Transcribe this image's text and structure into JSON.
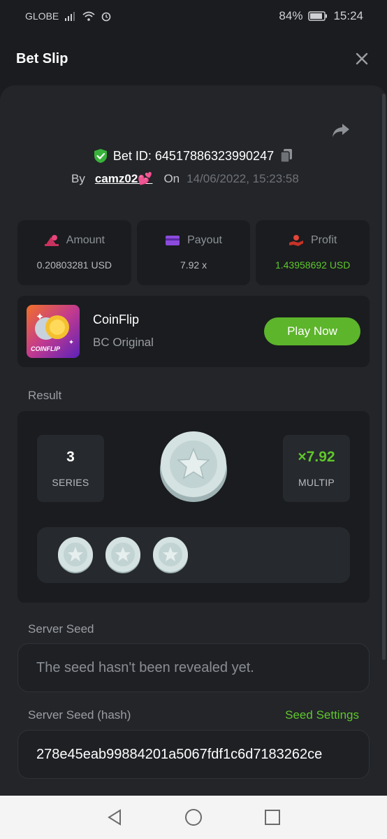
{
  "status_bar": {
    "carrier": "GLOBE",
    "battery": "84%",
    "time": "15:24"
  },
  "header": {
    "title": "Bet Slip"
  },
  "bet": {
    "id_label": "Bet ID: 64517886323990247",
    "by_label": "By",
    "username": "camz02💕",
    "on_label": "On",
    "datetime": "14/06/2022, 15:23:58"
  },
  "stats": [
    {
      "label": "Amount",
      "value": "0.20803281 USD",
      "icon": "coins-icon"
    },
    {
      "label": "Payout",
      "value": "7.92 x",
      "icon": "card-icon"
    },
    {
      "label": "Profit",
      "value": "1.43958692 USD",
      "icon": "hand-coin-icon"
    }
  ],
  "game": {
    "thumb_text": "COINFLIP",
    "name": "CoinFlip",
    "subtitle": "BC Original",
    "play_label": "Play Now"
  },
  "result": {
    "section_label": "Result",
    "series_value": "3",
    "series_label": "SERIES",
    "multiplier_value": "×7.92",
    "multiplier_label": "MULTIP",
    "coin_count": 3
  },
  "server_seed": {
    "label": "Server Seed",
    "placeholder": "The seed hasn't been revealed yet."
  },
  "server_seed_hash": {
    "label": "Server Seed (hash)",
    "settings_link": "Seed Settings",
    "value": "278e45eab99884201a5067fdf1c6d7183262ce"
  },
  "colors": {
    "accent_green": "#5fc72c",
    "button_green": "#5db52b",
    "background": "#1a1c1f",
    "panel": "#232529"
  }
}
